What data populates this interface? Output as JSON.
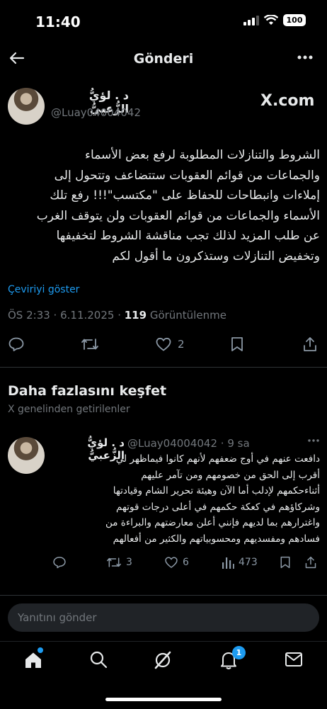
{
  "status": {
    "time": "11:40",
    "battery": "100"
  },
  "header": {
    "title": "Gönderi"
  },
  "post": {
    "author_name": "د . لؤيُّ الزُّعبيُّ",
    "handle": "@Luay04004042",
    "brand": "X.com",
    "text_lines": [
      "الشروط والتنازلات المطلوبة لرفع بعض الأسماء",
      "والجماعات من قوائم العقوبات ستتضاعف وتتحول إلى",
      "إملاءات وانبطاحات للحفاظ على \"مكتسب\"!!! رفع تلك",
      "الأسماء والجماعات من قوائم العقوبات ولن يتوقف الغرب",
      "عن طلب المزيد لذلك تجب مناقشة الشروط لتخفيفها",
      "وتخفيض التنازلات وستذكرون ما أقول لكم"
    ],
    "translate": "Çeviriyi göster",
    "time": "ÖS 2:33 · 6.11.2025 · ",
    "views_count": "119",
    "views_label": " Görüntülenme",
    "likes": "2"
  },
  "discover": {
    "title": "Daha fazlasını keşfet",
    "subtitle": "X genelinden getirilenler"
  },
  "reply": {
    "author_name": "د . لؤيُّ الزُّعبيُّ",
    "handle_time": "@Luay04004042 · 9 sa",
    "text_lines": [
      "دافعت عنهم في أوج ضعفهم لأنهم كانوا فيماظهر لي",
      "أقرب إلى الحق من خصومهم ومن تآمر عليهم",
      "أثناءحكمهم لإدلب أما الآن وهيئة تحرير الشام وقيادتها",
      "وشركاؤهم في كعكة حكمهم في أعلى درجات قوتهم",
      "واغترارهم بما لديهم فإنني أعلن معارضتهم والبراءة من",
      "فسادهم ومفسديهم ومحسوبياتهم والكثير من أفعالهم"
    ],
    "retweets": "3",
    "likes": "6",
    "views": "473"
  },
  "compose": {
    "placeholder": "Yanıtını gönder"
  },
  "tabbar": {
    "notifications_badge": "1"
  },
  "colors": {
    "accent": "#1d9bf0",
    "background": "#000000",
    "muted": "#71767b"
  }
}
